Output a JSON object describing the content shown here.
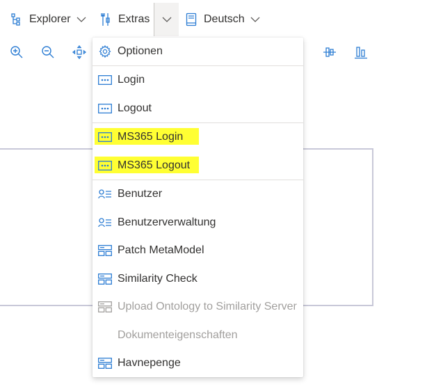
{
  "toolbar": {
    "explorer_label": "Explorer",
    "extras_label": "Extras",
    "language_label": "Deutsch"
  },
  "icon_row": [
    "zoom-in-icon",
    "zoom-out-icon",
    "fit-to-screen-icon",
    "align-center-icon",
    "align-bottom-icon"
  ],
  "menu": {
    "items": [
      {
        "label": "Optionen",
        "icon": "gear-icon",
        "disabled": false,
        "highlighted": false
      },
      {
        "label": "Login",
        "icon": "dots-box-icon",
        "disabled": false,
        "highlighted": false
      },
      {
        "label": "Logout",
        "icon": "dots-box-icon",
        "disabled": false,
        "highlighted": false
      },
      {
        "label": "MS365 Login",
        "icon": "dots-box-icon",
        "disabled": false,
        "highlighted": true
      },
      {
        "label": "MS365 Logout",
        "icon": "dots-box-icon",
        "disabled": false,
        "highlighted": true
      },
      {
        "label": "Benutzer",
        "icon": "user-list-icon",
        "disabled": false,
        "highlighted": false
      },
      {
        "label": "Benutzerverwaltung",
        "icon": "user-list-icon",
        "disabled": false,
        "highlighted": false
      },
      {
        "label": "Patch MetaModel",
        "icon": "blocks-icon",
        "disabled": false,
        "highlighted": false
      },
      {
        "label": "Similarity Check",
        "icon": "blocks-icon",
        "disabled": false,
        "highlighted": false
      },
      {
        "label": "Upload Ontology to Similarity Server",
        "icon": "blocks-icon",
        "disabled": true,
        "highlighted": false
      },
      {
        "label": "Dokumenteigenschaften",
        "icon": "",
        "disabled": true,
        "highlighted": false
      },
      {
        "label": "Havnepenge",
        "icon": "blocks-icon",
        "disabled": false,
        "highlighted": false
      }
    ]
  },
  "colors": {
    "accent": "#0078d4",
    "highlight": "#ffff33",
    "disabled_text": "#a19f9d",
    "text": "#323130"
  }
}
